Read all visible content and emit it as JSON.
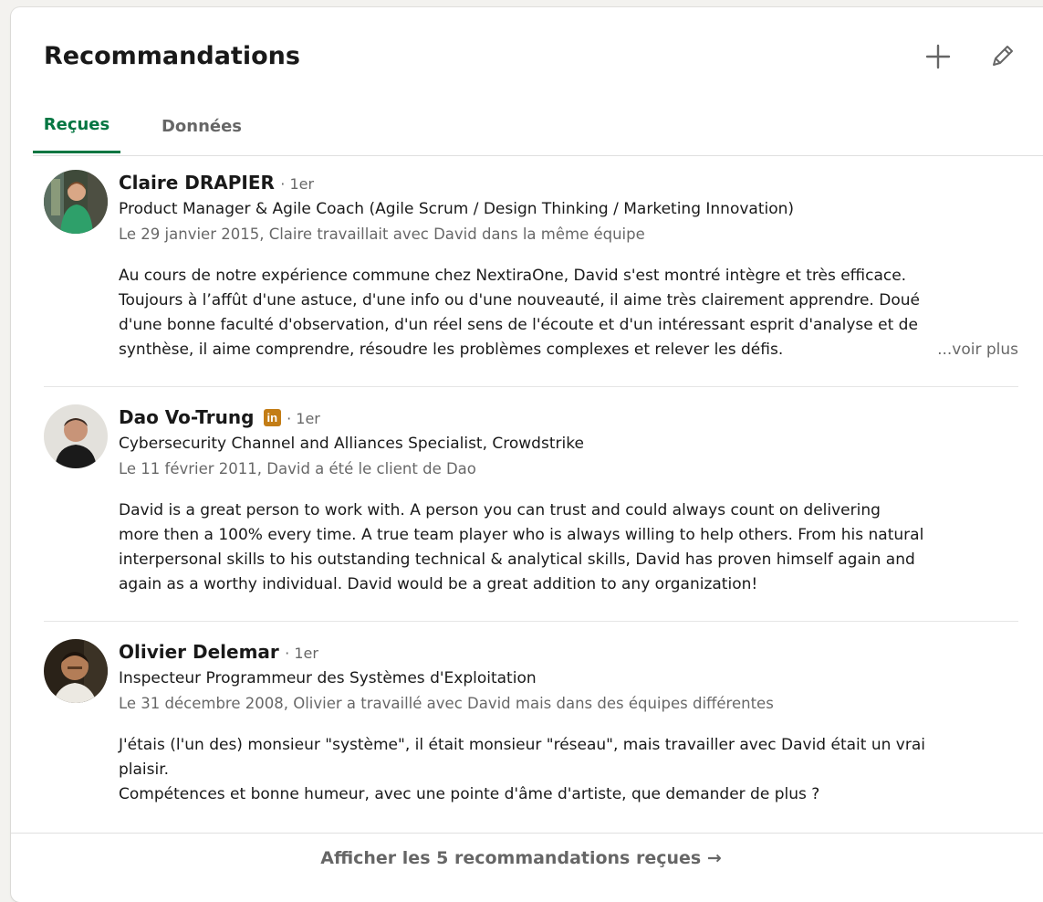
{
  "section": {
    "title": "Recommandations",
    "add_icon": "plus-icon",
    "edit_icon": "pencil-icon"
  },
  "tabs": [
    {
      "label": "Reçues",
      "active": true
    },
    {
      "label": "Données",
      "active": false
    }
  ],
  "colors": {
    "accent": "#057642",
    "linkedin_badge": "#c37d16",
    "muted_text": "#666666"
  },
  "recommendations": [
    {
      "name": "Claire DRAPIER",
      "badge": "",
      "degree": "· 1er",
      "headline": "Product Manager & Agile Coach (Agile Scrum / Design Thinking / Marketing Innovation)",
      "meta": "Le 29 janvier 2015, Claire travaillait avec David dans la même équipe",
      "text_lines": [
        "Au cours de notre expérience commune chez NextiraOne, David s'est montré intègre et très efficace.",
        "Toujours à l’affût d'une astuce, d'une info ou d'une nouveauté, il aime très clairement apprendre. Doué",
        "d'une bonne faculté d'observation, d'un réel sens de l'écoute et d'un intéressant esprit d'analyse et de",
        "synthèse, il aime comprendre, résoudre les problèmes complexes et relever les défis."
      ],
      "see_more": "...voir plus"
    },
    {
      "name": "Dao Vo-Trung",
      "badge": "in",
      "degree": "· 1er",
      "headline": "Cybersecurity Channel and Alliances Specialist, Crowdstrike",
      "meta": "Le 11 février 2011, David a été le client de Dao",
      "text_lines": [
        "David is a great person to work with. A person you can trust and could always count on delivering",
        "more then a 100% every time. A true team player who is always willing to help others. From his natural",
        "interpersonal skills to his outstanding technical & analytical skills, David has proven himself again and",
        "again as a worthy individual. David would be a great addition to any organization!"
      ],
      "see_more": ""
    },
    {
      "name": "Olivier Delemar",
      "badge": "",
      "degree": "· 1er",
      "headline": "Inspecteur Programmeur des Systèmes d'Exploitation",
      "meta": "Le 31 décembre 2008, Olivier a travaillé avec David mais dans des équipes différentes",
      "text_lines": [
        "J'étais (l'un des) monsieur \"système\", il était monsieur \"réseau\", mais travailler avec David était un vrai",
        "plaisir.",
        "Compétences et bonne humeur, avec une pointe d'âme d'artiste, que demander de plus ?"
      ],
      "see_more": ""
    }
  ],
  "footer": {
    "label": "Afficher les 5 recommandations reçues →"
  }
}
